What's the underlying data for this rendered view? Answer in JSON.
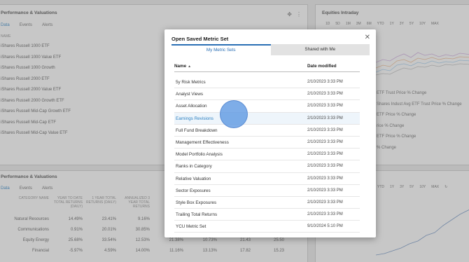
{
  "background": {
    "top_left": {
      "title": "Performance & Valuations",
      "tabs": [
        "Data",
        "Events",
        "Alerts"
      ],
      "column_header": "NAME",
      "funds": [
        "iShares Russell 1000 ETF",
        "iShares Russell 1000 Value ETF",
        "iShares Russell 1000 Growth",
        "iShares Russell 2000 ETF",
        "iShares Russell 2000 Value ETF",
        "iShares Russell 2000 Growth ETF",
        "iShares Russell Mid-Cap Growth ETF",
        "iShares Russell Mid-Cap ETF",
        "iShares Russell Mid-Cap Value ETF"
      ]
    },
    "top_right": {
      "title": "Equities Intraday",
      "ranges": [
        "1D",
        "5D",
        "1M",
        "3M",
        "6M",
        "YTD",
        "1Y",
        "3Y",
        "5Y",
        "10Y",
        "MAX"
      ],
      "legend": [
        "ETF Trust Price % Change",
        "Shares Indust Avg ETF Trust Price % Change",
        "ETF Price % Change",
        "rice % Change",
        "ETF Price % Change",
        "% Change"
      ]
    },
    "bottom_left": {
      "title": "Performance & Valuations",
      "tabs": [
        "Data",
        "Events",
        "Alerts"
      ],
      "headers": [
        "CATEGORY NAME",
        "YEAR TO DATE TOTAL RETURNS (DAILY)",
        "1 YEAR TOTAL RETURNS (DAILY)",
        "ANNUALIZED 3 YEAR TOTAL RETURNS"
      ],
      "rows": [
        [
          "Natural Resources",
          "14.49%",
          "23.41%",
          "9.16%",
          "",
          "",
          "",
          ""
        ],
        [
          "Communications",
          "0.91%",
          "20.01%",
          "30.85%",
          "",
          "",
          "",
          ""
        ],
        [
          "Equity Energy",
          "25.68%",
          "33.54%",
          "12.53%",
          "21.38%",
          "10.73%",
          "21.43",
          "25.50"
        ],
        [
          "Financial",
          "-5.97%",
          "4.59%",
          "14.00%",
          "11.16%",
          "13.13%",
          "17.82",
          "15.23"
        ]
      ]
    },
    "bottom_right": {
      "ranges": [
        "YTD",
        "1Y",
        "3Y",
        "5Y",
        "10Y",
        "MAX"
      ]
    }
  },
  "modal": {
    "title": "Open Saved Metric Set",
    "close_icon": "close-icon",
    "tabs": [
      {
        "label": "My Metric Sets",
        "active": true
      },
      {
        "label": "Shared with Me",
        "active": false
      }
    ],
    "columns": {
      "name": "Name",
      "sort": "▲",
      "date": "Date modified"
    },
    "rows": [
      {
        "name": "5y Risk Metrics",
        "date": "2/10/2023 3:33 PM"
      },
      {
        "name": "Analyst Views",
        "date": "2/10/2023 3:33 PM"
      },
      {
        "name": "Asset Allocation",
        "date": "2/10/2023 3:33 PM"
      },
      {
        "name": "Earnings Revisions",
        "date": "2/10/2023 3:33 PM"
      },
      {
        "name": "Full Fund Breakdown",
        "date": "2/10/2023 3:33 PM"
      },
      {
        "name": "Management Effectiveness",
        "date": "2/10/2023 3:33 PM"
      },
      {
        "name": "Model Portfolio Analysis",
        "date": "2/10/2023 3:33 PM"
      },
      {
        "name": "Ranks in Category",
        "date": "2/10/2023 3:33 PM"
      },
      {
        "name": "Relative Valuation",
        "date": "2/10/2023 3:33 PM"
      },
      {
        "name": "Sector Exposures",
        "date": "2/10/2023 3:33 PM"
      },
      {
        "name": "Style Box Exposures",
        "date": "2/10/2023 3:33 PM"
      },
      {
        "name": "Trailing Total Returns",
        "date": "2/10/2023 3:33 PM"
      },
      {
        "name": "YCU Metric Set",
        "date": "9/10/2024 5:10 PM"
      }
    ],
    "highlighted_row": "Earnings Revisions"
  },
  "colors": {
    "accent": "#2a6fb5",
    "link": "#2a7fc0",
    "highlight_row": "#eef5fb",
    "overlay": "#787878"
  }
}
